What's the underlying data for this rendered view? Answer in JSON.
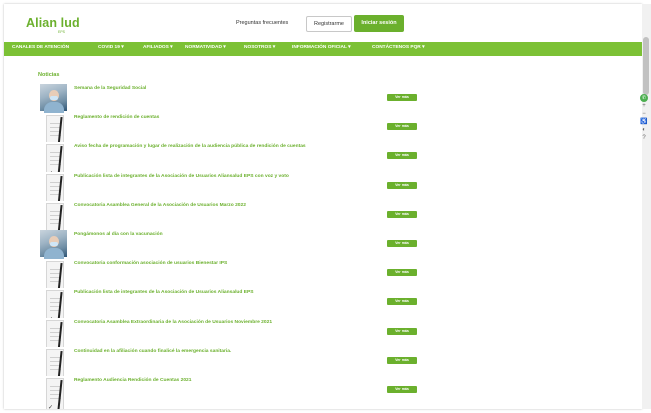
{
  "header": {
    "logo_text": "Alian  lud",
    "logo_sub": "EPS",
    "faq_link": "Preguntas frecuentes",
    "register_button": "Registrarme",
    "login_button": "Iniciar sesión"
  },
  "nav": {
    "items": [
      "CANALES DE ATENCIÓN",
      "COVID 19 ▾",
      "AFILIADOS ▾",
      "NORMATIVIDAD ▾",
      "NOSOTROS ▾",
      "INFORMACIÓN OFICIAL ▾",
      "CONTÁCTENOS PQR ▾"
    ]
  },
  "main": {
    "section_title": "Noticias",
    "button_label": "Ver más",
    "news": [
      {
        "title": "Semana de la Seguridad Social",
        "thumb": "photo"
      },
      {
        "title": "Reglamento de rendición de cuentas",
        "thumb": "document"
      },
      {
        "title": "Aviso fecha de programación y lugar de realización de la audiencia pública de rendición de cuentas",
        "thumb": "document"
      },
      {
        "title": "Publicación lista de integrantes de la Asociación de Usuarios Aliansalud EPS con voz y voto",
        "thumb": "document"
      },
      {
        "title": "Convocatoria Asamblea General de la Asociación de Usuarios Marzo 2022",
        "thumb": "document"
      },
      {
        "title": "Pongámonos al día con la vacunación",
        "thumb": "photo"
      },
      {
        "title": "Convocatoria conformación asociación de usuarios Bienestar IPS",
        "thumb": "document"
      },
      {
        "title": "Publicación lista de integrantes de la Asociación de Usuarios Aliansalud EPS",
        "thumb": "document"
      },
      {
        "title": "Convocatoria Asamblea Extraordinaria de la Asociación de Usuarios Noviembre 2021",
        "thumb": "document"
      },
      {
        "title": "Continuidad en la afiliación cuando finalicé la emergencia sanitaria.",
        "thumb": "document"
      },
      {
        "title": "Reglamento Audiencia Rendición de Cuentas 2021",
        "thumb": "document"
      }
    ]
  },
  "side_icons": [
    "whatsapp-icon",
    "plus-icon",
    "minus-icon",
    "accessibility-icon",
    "contrast-icon",
    "help-icon"
  ],
  "colors": {
    "brand_green": "#6bb02d",
    "nav_green": "#7cc135"
  }
}
